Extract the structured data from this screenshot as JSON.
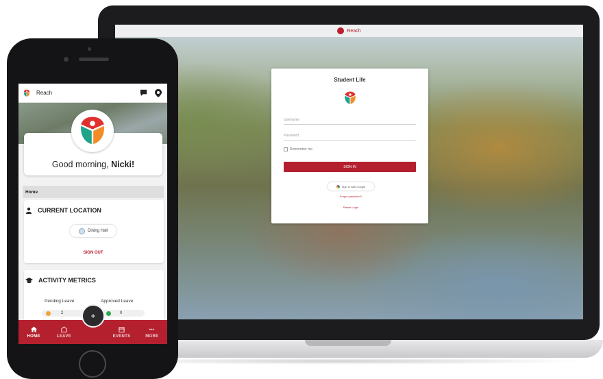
{
  "laptop": {
    "topbar_brand": "Reach",
    "login": {
      "title": "Student Life",
      "username_placeholder": "Username",
      "password_placeholder": "Password",
      "remember_label": "Remember me",
      "signin_label": "SIGN IN",
      "google_label": "Sign in with Google",
      "link_forgot": "Forgot password?",
      "link_parent": "Parent Login"
    }
  },
  "phone": {
    "app_name": "Reach",
    "greeting_prefix": "Good morning, ",
    "greeting_name": "Nicki!",
    "breadcrumb": "Home",
    "location": {
      "title": "CURRENT LOCATION",
      "place": "Dining Hall",
      "action": "SIGN OUT"
    },
    "metrics": {
      "title": "ACTIVITY METRICS",
      "pending_label": "Pending Leave",
      "approved_label": "Approved Leave",
      "pending_value": "2",
      "approved_value": "0"
    },
    "fab_label": "+",
    "nav": [
      {
        "label": "HOME",
        "icon": "home-icon"
      },
      {
        "label": "LEAVE",
        "icon": "leave-icon"
      },
      {
        "label": "EVENTS",
        "icon": "calendar-icon"
      },
      {
        "label": "MORE",
        "icon": "more-icon"
      }
    ]
  },
  "colors": {
    "brand_red": "#b5202e",
    "logo_red": "#e0312f",
    "logo_orange": "#f28c28",
    "logo_teal": "#1fa38a"
  }
}
